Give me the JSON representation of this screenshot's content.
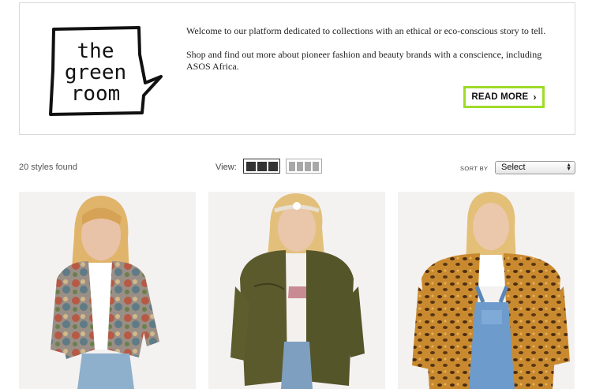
{
  "banner": {
    "logo_lines": [
      "the",
      "green",
      "room"
    ],
    "welcome_text": "Welcome to our platform dedicated to collections with an ethical or eco-conscious story to tell.",
    "shop_text": "Shop and find out more about pioneer fashion and beauty brands with a conscience, including ASOS Africa.",
    "read_more_label": "READ MORE",
    "read_more_icon": "chevron-right-icon",
    "accent_color": "#9fdc28"
  },
  "toolbar": {
    "styles_found": "20 styles found",
    "view_label": "View:",
    "view_options": [
      "three-column",
      "four-column"
    ],
    "selected_view": "three-column",
    "sort_label": "SORT BY",
    "sort_value": "Select"
  },
  "products": [
    {
      "image": "model-in-floral-tapestry-jacket"
    },
    {
      "image": "model-in-khaki-military-parka"
    },
    {
      "image": "model-in-leopard-print-jacket-and-denim-dungarees"
    }
  ]
}
